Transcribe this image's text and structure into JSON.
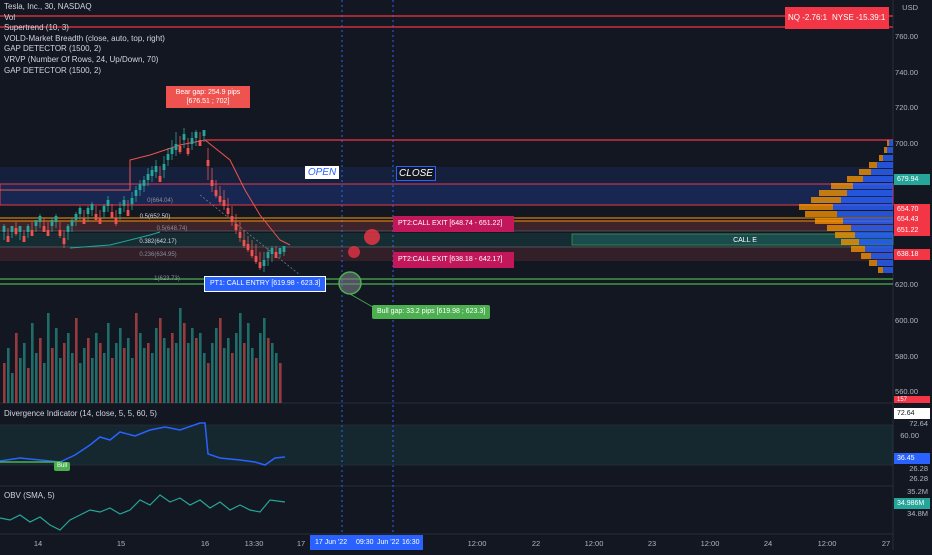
{
  "legend": [
    "Tesla, Inc., 30, NASDAQ",
    "Vol",
    "Supertrend (10, 3)",
    "VOLD-Market Breadth (close, auto, top, right)",
    "GAP DETECTOR (1500, 2)",
    "VRVP (Number Of Rows, 24, Up/Down, 70)",
    "GAP DETECTOR (1500, 2)"
  ],
  "currency": "USD",
  "breadth": {
    "nq": "NQ -2.76:1",
    "nyse": "NYSE -15.39:1"
  },
  "annotations": {
    "open_label": "OPEN",
    "close_label": "CLOSE",
    "bear_gap": "Bear gap: 254.9 pips",
    "bear_gap_range": "[676.51 ; 702]",
    "bull_gap": "Bull gap: 33.2 pips [619.98 ; 623.3]",
    "pt1": "PT1: CALL ENTRY [619.98 - 623.3]",
    "pt2_upper": "PT2:CALL EXIT [648.74 - 651.22]",
    "pt2_lower": "PT2:CALL EXIT [638.18 - 642.17]",
    "call_label": "CALL E",
    "fib_labels": [
      "0(664.04)",
      "0.5(652.50)",
      "0.5(648.74)",
      "0.382(642.17)",
      "0.236(634.95)",
      "1(623.73)"
    ]
  },
  "price_axis": {
    "ticks": [
      "760.00",
      "740.00",
      "720.00",
      "700.00",
      "620.00",
      "600.00",
      "580.00",
      "560.00"
    ],
    "tags": [
      {
        "value": "679.94",
        "color": "#26a69a"
      },
      {
        "value": "654.70",
        "color": "#f23645"
      },
      {
        "value": "654.43",
        "color": "#f23645"
      },
      {
        "value": "651.22",
        "color": "#f23645"
      },
      {
        "value": "638.18",
        "color": "#f23645"
      }
    ],
    "partial_tag": "157"
  },
  "divergence": {
    "title": "Divergence Indicator (14, close, 5, 5, 60, 5)",
    "axis": [
      "72.64",
      "72.64",
      "60.00",
      "36.45",
      "26.28",
      "26.28"
    ],
    "bull_label": "Bull"
  },
  "obv": {
    "title": "OBV (SMA, 5)",
    "axis": [
      "35.2M",
      "34.986M",
      "34.8M"
    ]
  },
  "time_axis": {
    "labels": [
      "14",
      "15",
      "16",
      "13:30",
      "17",
      "12:00",
      "22",
      "12:00",
      "23",
      "12:00",
      "24",
      "12:00",
      "27"
    ],
    "highlight": [
      "17 Jun '22",
      "09:30",
      "Jun '22",
      "16:30"
    ]
  },
  "colors": {
    "background": "#131722",
    "up": "#26a69a",
    "down": "#ef5350",
    "blue": "#2962ff",
    "accent_red": "#f23645"
  }
}
